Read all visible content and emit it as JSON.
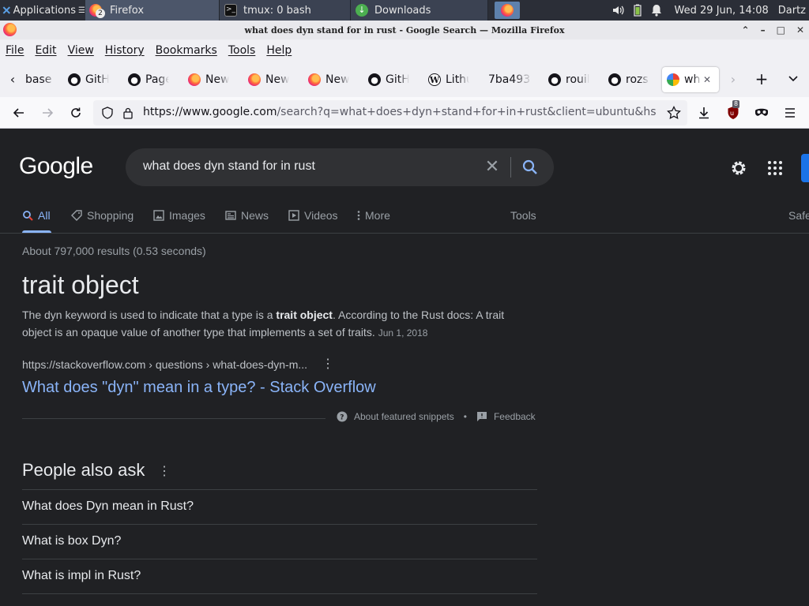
{
  "taskbar": {
    "applications_label": "Applications",
    "applications_more": "☰",
    "windows": [
      {
        "label": "Firefox",
        "badge": "2"
      },
      {
        "label": "tmux: 0 bash"
      },
      {
        "label": "Downloads"
      }
    ],
    "clock": "Wed 29 Jun, 14:08",
    "user": "Dartz"
  },
  "window": {
    "title": "what does dyn stand for in rust - Google Search — Mozilla Firefox"
  },
  "menubar": {
    "items": [
      "File",
      "Edit",
      "View",
      "History",
      "Bookmarks",
      "Tools",
      "Help"
    ]
  },
  "tabs": [
    {
      "label": "base",
      "icon": "none"
    },
    {
      "label": "GitHub",
      "icon": "github-icon"
    },
    {
      "label": "Page",
      "icon": "github-icon"
    },
    {
      "label": "New",
      "icon": "firefox-icon"
    },
    {
      "label": "New",
      "icon": "firefox-icon"
    },
    {
      "label": "New",
      "icon": "firefox-icon"
    },
    {
      "label": "GitHub",
      "icon": "github-icon"
    },
    {
      "label": "Lithu",
      "icon": "wikipedia-icon"
    },
    {
      "label": "7ba493",
      "icon": "none"
    },
    {
      "label": "rouill",
      "icon": "github-icon"
    },
    {
      "label": "rozsa",
      "icon": "github-icon"
    },
    {
      "label": "wh",
      "icon": "google-icon",
      "active": true
    }
  ],
  "navbar": {
    "url_host": "https://www.google.com",
    "url_rest": "/search?q=what+does+dyn+stand+for+in+rust&client=ubuntu&hs=",
    "ublock_count": "8"
  },
  "google": {
    "logo": "Google",
    "query": "what does dyn stand for in rust",
    "nav_tabs": [
      {
        "label": "All",
        "icon": "search-icon",
        "active": true
      },
      {
        "label": "Shopping",
        "icon": "tag-icon"
      },
      {
        "label": "Images",
        "icon": "image-icon"
      },
      {
        "label": "News",
        "icon": "news-icon"
      },
      {
        "label": "Videos",
        "icon": "video-icon"
      },
      {
        "label": "More",
        "icon": "more-vert-icon"
      }
    ],
    "tools_label": "Tools",
    "safesearch_label": "Safe",
    "result_stats": "About 797,000 results (0.53 seconds)",
    "featured": {
      "answer": "trait object",
      "snippet_before": "The dyn keyword is used to indicate that a type is a ",
      "snippet_bold": "trait object",
      "snippet_after": ". According to the Rust docs: A trait object is an opaque value of another type that implements a set of traits.",
      "date": "Jun 1, 2018",
      "source_url": "https://stackoverflow.com › questions › what-does-dyn-m...",
      "link_title": "What does \"dyn\" mean in a type? - Stack Overflow",
      "about_label": "About featured snippets",
      "feedback_label": "Feedback",
      "bullet": "•"
    },
    "people_also_ask": {
      "title": "People also ask",
      "questions": [
        "What does Dyn mean in Rust?",
        "What is box Dyn?",
        "What is impl in Rust?"
      ]
    }
  },
  "colors": {
    "page_bg": "#202124",
    "link": "#8ab4f8",
    "text": "#bdc1c6"
  }
}
